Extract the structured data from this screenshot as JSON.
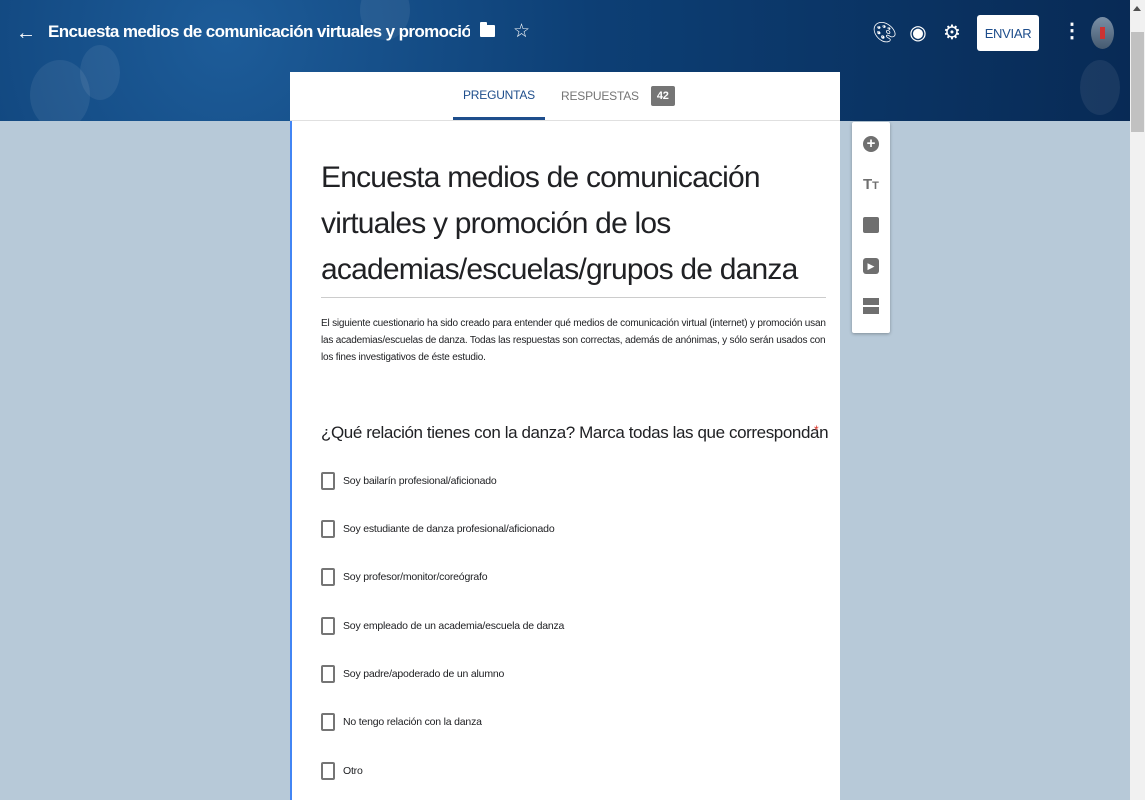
{
  "header": {
    "title": "Encuesta medios de comunicación virtuales y promoción de los academias/escuelas/grupos de danza",
    "send_label": "ENVIAR"
  },
  "tabs": {
    "questions": "PREGUNTAS",
    "responses": "RESPUESTAS",
    "responses_count": "42"
  },
  "form": {
    "title": "Encuesta medios de comunicación virtuales y promoción de los academias/escuelas/grupos de danza",
    "description": "El siguiente cuestionario ha sido creado para entender qué medios de comunicación virtual (internet) y promoción usan las  academias/escuelas de danza. Todas las respuestas son correctas, además de anónimas, y sólo serán usados con los fines investigativos de éste estudio.",
    "question": {
      "text": "¿Qué relación tienes con la danza?  Marca todas las que correspondan",
      "required_mark": "*",
      "options": [
        "Soy bailarín profesional/aficionado",
        "Soy estudiante de danza profesional/aficionado",
        "Soy profesor/monitor/coreógrafo",
        "Soy empleado de un academia/escuela de danza",
        "Soy padre/apoderado de un alumno",
        "No tengo relación con la danza",
        "Otro"
      ]
    }
  },
  "colors": {
    "accent": "#1e4e8c",
    "form_border": "#4285f4",
    "background": "#b7c9d8"
  }
}
